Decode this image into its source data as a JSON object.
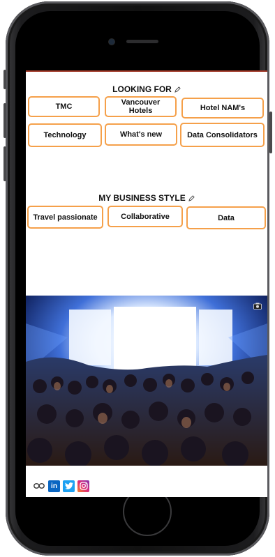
{
  "looking_for": {
    "title": "LOOKING FOR",
    "chips": [
      "TMC",
      "Vancouver Hotels",
      "Hotel NAM's",
      "Technology",
      "What's new",
      "Data Consolidators"
    ]
  },
  "business_style": {
    "title": "MY BUSINESS STYLE",
    "chips": [
      "Travel passionate",
      "Collaborative",
      "Data"
    ]
  },
  "social": {
    "linkedin_label": "in"
  },
  "colors": {
    "chip_border": "#f5a04a",
    "screen_top_border": "#a33a2a",
    "linkedin": "#0a66c2",
    "twitter": "#1da1f2",
    "instagram": "#e1306c"
  },
  "icons": [
    "pencil-icon",
    "camera-icon",
    "link-icon",
    "linkedin-icon",
    "twitter-icon",
    "instagram-icon"
  ]
}
